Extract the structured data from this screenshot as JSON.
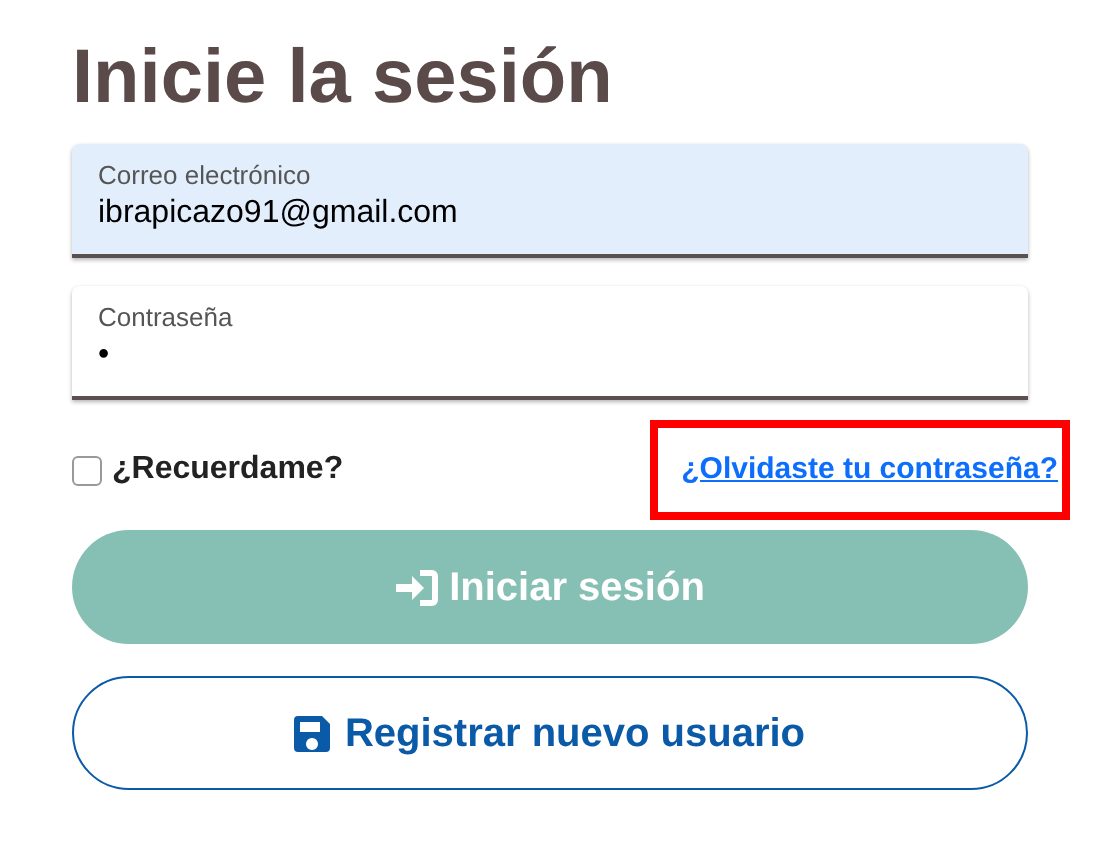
{
  "title": "Inicie la sesión",
  "fields": [
    {
      "label": "Correo electrónico",
      "value": "ibrapicazo91@gmail.com",
      "autofilled": true
    },
    {
      "label": "Contraseña",
      "value": "•",
      "autofilled": false
    }
  ],
  "remember": {
    "label": "¿Recuerdame?",
    "checked": false
  },
  "forgot_link": {
    "text": "¿Olvidaste tu contraseña?",
    "highlighted": true
  },
  "buttons": [
    {
      "kind": "primary",
      "label": "Iniciar sesión"
    },
    {
      "kind": "outline",
      "label": "Registrar nuevo usuario"
    }
  ]
}
